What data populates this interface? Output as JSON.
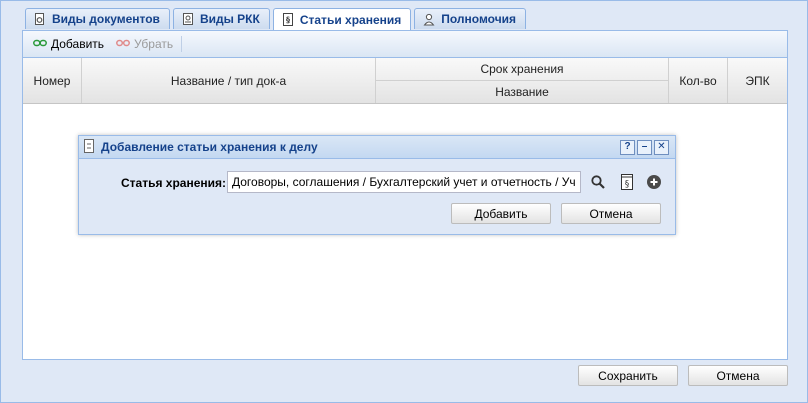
{
  "tabs": [
    {
      "label": "Виды документов",
      "icon": "gear-doc-icon"
    },
    {
      "label": "Виды РКК",
      "icon": "card-icon"
    },
    {
      "label": "Статьи хранения",
      "icon": "storage-doc-icon"
    },
    {
      "label": "Полномочия",
      "icon": "user-permission-icon"
    }
  ],
  "active_tab": 2,
  "toolbar": {
    "add_label": "Добавить",
    "remove_label": "Убрать"
  },
  "grid": {
    "columns": {
      "number": "Номер",
      "name_type": "Название / тип док-а",
      "storage_period": "Срок хранения",
      "storage_period_name": "Название",
      "count": "Кол-во",
      "epk": "ЭПК"
    }
  },
  "dialog": {
    "title": "Добавление статьи хранения к делу",
    "field_label": "Статья хранения:",
    "field_value": "Договоры, соглашения / Бухгалтерский учет и отчетность / Учет и о",
    "add_label": "Добавить",
    "cancel_label": "Отмена",
    "tool_help": "?",
    "tool_min": "–",
    "tool_close": "✕"
  },
  "footer": {
    "save_label": "Сохранить",
    "cancel_label": "Отмена"
  }
}
